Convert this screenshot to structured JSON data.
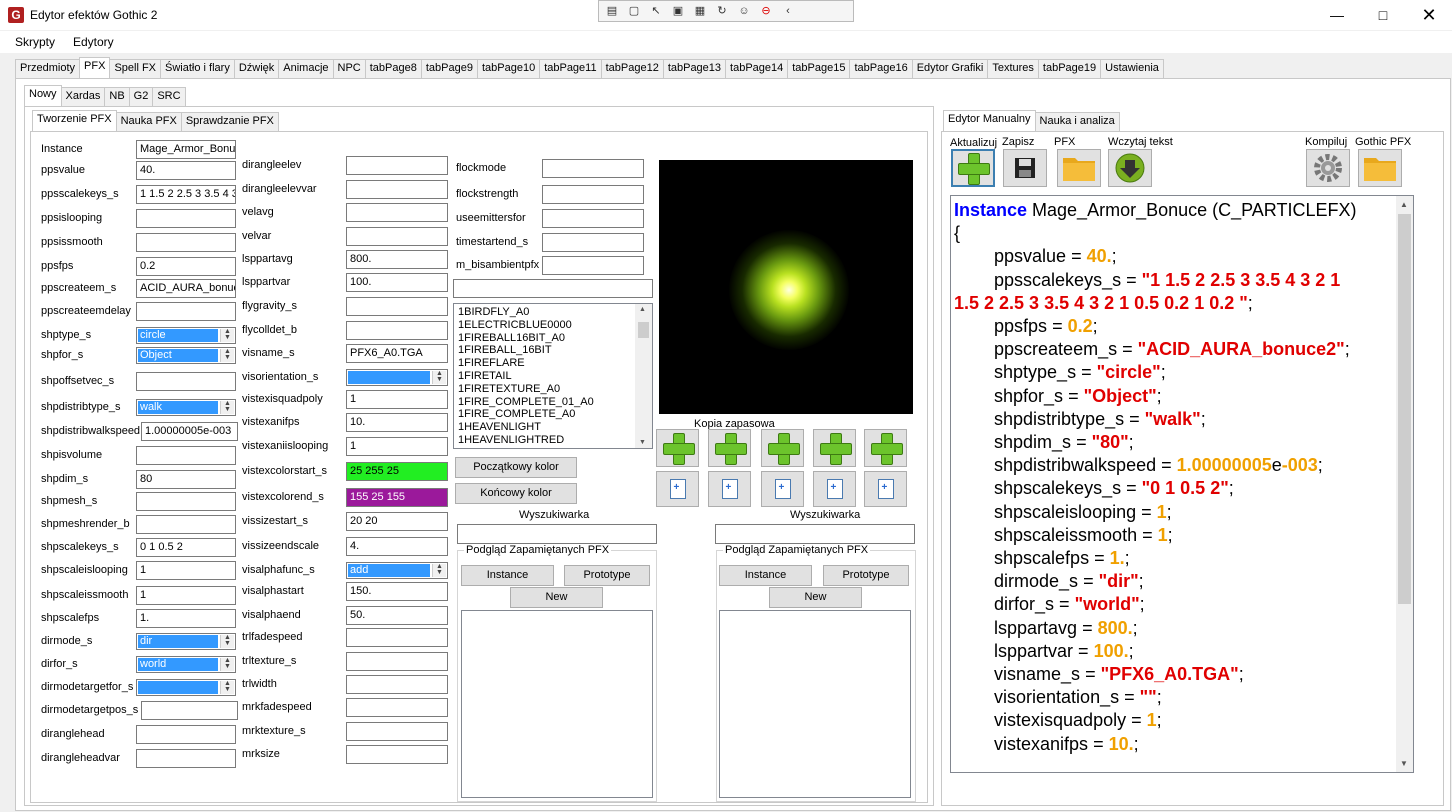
{
  "window": {
    "title": "Edytor efektów Gothic 2"
  },
  "menu": [
    "Skrypty",
    "Edytory"
  ],
  "main_tabs": [
    "Przedmioty",
    "PFX",
    "Spell FX",
    "Światło i flary",
    "Dźwięk",
    "Animacje",
    "NPC",
    "tabPage8",
    "tabPage9",
    "tabPage10",
    "tabPage11",
    "tabPage12",
    "tabPage13",
    "tabPage14",
    "tabPage15",
    "tabPage16",
    "Edytor Grafiki",
    "Textures",
    "tabPage19",
    "Ustawienia"
  ],
  "sub_tabs": [
    "Nowy",
    "Xardas",
    "NB",
    "G2",
    "SRC"
  ],
  "inner_tabs": [
    "Tworzenie PFX",
    "Nauka PFX",
    "Sprawdzanie PFX"
  ],
  "col1": [
    {
      "label": "Instance",
      "value": "Mage_Armor_Bonuc"
    },
    {
      "label": "ppsvalue",
      "value": "40."
    },
    {
      "label": "ppsscalekeys_s",
      "value": "1 1.5 2 2.5 3 3.5 4 3"
    },
    {
      "label": "ppsislooping",
      "value": ""
    },
    {
      "label": "ppsissmooth",
      "value": ""
    },
    {
      "label": "ppsfps",
      "value": "0.2"
    },
    {
      "label": "ppscreateem_s",
      "value": "ACID_AURA_bonuc"
    },
    {
      "label": "ppscreateemdelay",
      "value": ""
    },
    {
      "label": "shptype_s",
      "value": "circle",
      "dd": true
    },
    {
      "label": "shpfor_s",
      "value": "Object",
      "dd": true
    },
    {
      "label": "shpoffsetvec_s",
      "value": ""
    },
    {
      "label": "shpdistribtype_s",
      "value": "walk",
      "dd": true
    },
    {
      "label": "shpdistribwalkspeed",
      "value": "1.00000005e-003"
    },
    {
      "label": "shpisvolume",
      "value": ""
    },
    {
      "label": "shpdim_s",
      "value": "80"
    },
    {
      "label": "shpmesh_s",
      "value": ""
    },
    {
      "label": "shpmeshrender_b",
      "value": ""
    },
    {
      "label": "shpscalekeys_s",
      "value": "0 1 0.5 2"
    },
    {
      "label": "shpscaleislooping",
      "value": "1"
    },
    {
      "label": "shpscaleissmooth",
      "value": "1"
    },
    {
      "label": "shpscalefps",
      "value": "1."
    },
    {
      "label": "dirmode_s",
      "value": "dir",
      "dd": true
    },
    {
      "label": "dirfor_s",
      "value": "world",
      "dd": true
    },
    {
      "label": "dirmodetargetfor_s",
      "value": "",
      "dd": true
    },
    {
      "label": "dirmodetargetpos_s",
      "value": ""
    },
    {
      "label": "dirangleh​ead",
      "value": ""
    },
    {
      "label": "dirangleheadvar",
      "value": ""
    }
  ],
  "col2": [
    {
      "label": "dirangleelev",
      "value": ""
    },
    {
      "label": "dirangleelevvar",
      "value": ""
    },
    {
      "label": "velavg",
      "value": ""
    },
    {
      "label": "velvar",
      "value": ""
    },
    {
      "label": "lsppartavg",
      "value": "800."
    },
    {
      "label": "lsppartvar",
      "value": "100."
    },
    {
      "label": "flygravity_s",
      "value": ""
    },
    {
      "label": "flycolldet_b",
      "value": ""
    },
    {
      "label": "visname_s",
      "value": "PFX6_A0.TGA"
    },
    {
      "label": "visorientation_s",
      "value": "",
      "dd": true
    },
    {
      "label": "vistexisquadpoly",
      "value": "1"
    },
    {
      "label": "vistexanifps",
      "value": "10."
    },
    {
      "label": "vistexaniislooping",
      "value": "1"
    },
    {
      "label": "vistexcolorstart_s",
      "value": "25 255 25",
      "color": "#22ee22"
    },
    {
      "label": "vistexcolorend_s",
      "value": "155 25 155",
      "color": "#9b199b"
    },
    {
      "label": "vissizestart_s",
      "value": "20 20"
    },
    {
      "label": "vissizeendscale",
      "value": "4."
    },
    {
      "label": "visalphafunc_s",
      "value": "add",
      "dd": true
    },
    {
      "label": "visalphastart",
      "value": "150."
    },
    {
      "label": "visalphaend",
      "value": "50."
    },
    {
      "label": "trlfadespeed",
      "value": ""
    },
    {
      "label": "trltexture_s",
      "value": ""
    },
    {
      "label": "trlwidth",
      "value": ""
    },
    {
      "label": "mrkfadespeed",
      "value": ""
    },
    {
      "label": "mrktexture_s",
      "value": ""
    },
    {
      "label": "mrksize",
      "value": ""
    }
  ],
  "col3": [
    {
      "label": "flockmode",
      "value": ""
    },
    {
      "label": "flockstrength",
      "value": ""
    },
    {
      "label": "useemittersfor",
      "value": ""
    },
    {
      "label": "timestartend_s",
      "value": ""
    },
    {
      "label": "m_bisambientpfx",
      "value": ""
    }
  ],
  "pfx_list": [
    "1BIRDFLY_A0",
    "1ELECTRICBLUE0000",
    "1FIREBALL16BIT_A0",
    "1FIREBALL_16BIT",
    "1FIREFLARE",
    "1FIRETAIL",
    "1FIRETEXTURE_A0",
    "1FIRE_COMPLETE_01_A0",
    "1FIRE_COMPLETE_A0",
    "1HEAVENLIGHT",
    "1HEAVENLIGHTRED"
  ],
  "color_buttons": {
    "start": "Początkowy kolor",
    "end": "Końcowy kolor"
  },
  "backup_label": "Kopia zapasowa",
  "search_label": "Wyszukiwarka",
  "saved_group": "Podgląd Zapamiętanych  PFX",
  "saved_buttons": {
    "instance": "Instance",
    "prototype": "Prototype",
    "new": "New"
  },
  "right_tabs": [
    "Edytor Manualny",
    "Nauka i analiza"
  ],
  "toolbar": [
    "Aktualizuj",
    "Zapisz",
    "PFX",
    "Wczytaj tekst",
    "Kompiluj",
    "Gothic PFX"
  ],
  "code": {
    "header_kw": "Instance",
    "header_rest": " Mage_Armor_Bonuce (C_PARTICLEFX)",
    "brace": "{",
    "lines": [
      {
        "k": "ppsvalue",
        "v": "40.",
        "t": "num"
      },
      {
        "k": "ppsscalekeys_s",
        "v": "\"1 1.5 2 2.5 3 3.5 4 3 2 1",
        "t": "str"
      },
      {
        "k": "",
        "v": "1.5 2 2.5 3 3.5 4 3 2 1 0.5 0.2 1 0.2 \"",
        "t": "strcont"
      },
      {
        "k": "ppsfps",
        "v": "0.2",
        "t": "num"
      },
      {
        "k": "ppscreateem_s",
        "v": "\"ACID_AURA_bonuce2\"",
        "t": "str"
      },
      {
        "k": "shptype_s",
        "v": "\"circle\"",
        "t": "str"
      },
      {
        "k": "shpfor_s",
        "v": "\"Object\"",
        "t": "str"
      },
      {
        "k": "shpdistribtype_s",
        "v": "\"walk\"",
        "t": "str"
      },
      {
        "k": "shpdim_s",
        "v": "\"80\"",
        "t": "str"
      },
      {
        "k": "shpdistribwalkspeed",
        "v": "1.00000005e-003",
        "t": "sci"
      },
      {
        "k": "shpscalekeys_s",
        "v": "\"0 1 0.5 2\"",
        "t": "str"
      },
      {
        "k": "shpscaleislooping",
        "v": "1",
        "t": "num"
      },
      {
        "k": "shpscaleissmooth",
        "v": "1",
        "t": "num"
      },
      {
        "k": "shpscalefps",
        "v": "1.",
        "t": "num"
      },
      {
        "k": "dirmode_s",
        "v": "\"dir\"",
        "t": "str"
      },
      {
        "k": "dirfor_s",
        "v": "\"world\"",
        "t": "str"
      },
      {
        "k": "lsppartavg",
        "v": "800.",
        "t": "num"
      },
      {
        "k": "lsppartvar",
        "v": "100.",
        "t": "num"
      },
      {
        "k": "visname_s",
        "v": "\"PFX6_A0.TGA\"",
        "t": "str"
      },
      {
        "k": "visorientation_s",
        "v": "\"\"",
        "t": "str"
      },
      {
        "k": "vistexisquadpoly",
        "v": "1",
        "t": "num"
      },
      {
        "k": "vistexanifps",
        "v": "10.",
        "t": "num"
      }
    ]
  }
}
